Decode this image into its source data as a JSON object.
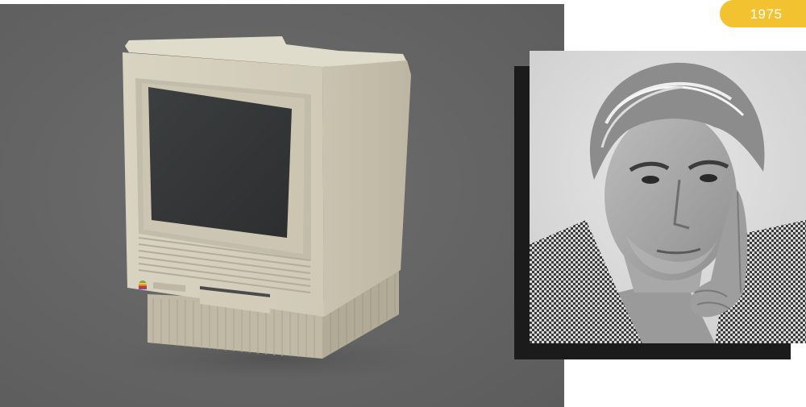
{
  "badge": {
    "year": "1975",
    "color": "#f2c230"
  },
  "product_image": {
    "icon": "vintage-computer-image",
    "background": "#636363"
  },
  "portrait_image": {
    "icon": "portrait-photo-image",
    "frame_color": "#1b1b1b"
  }
}
